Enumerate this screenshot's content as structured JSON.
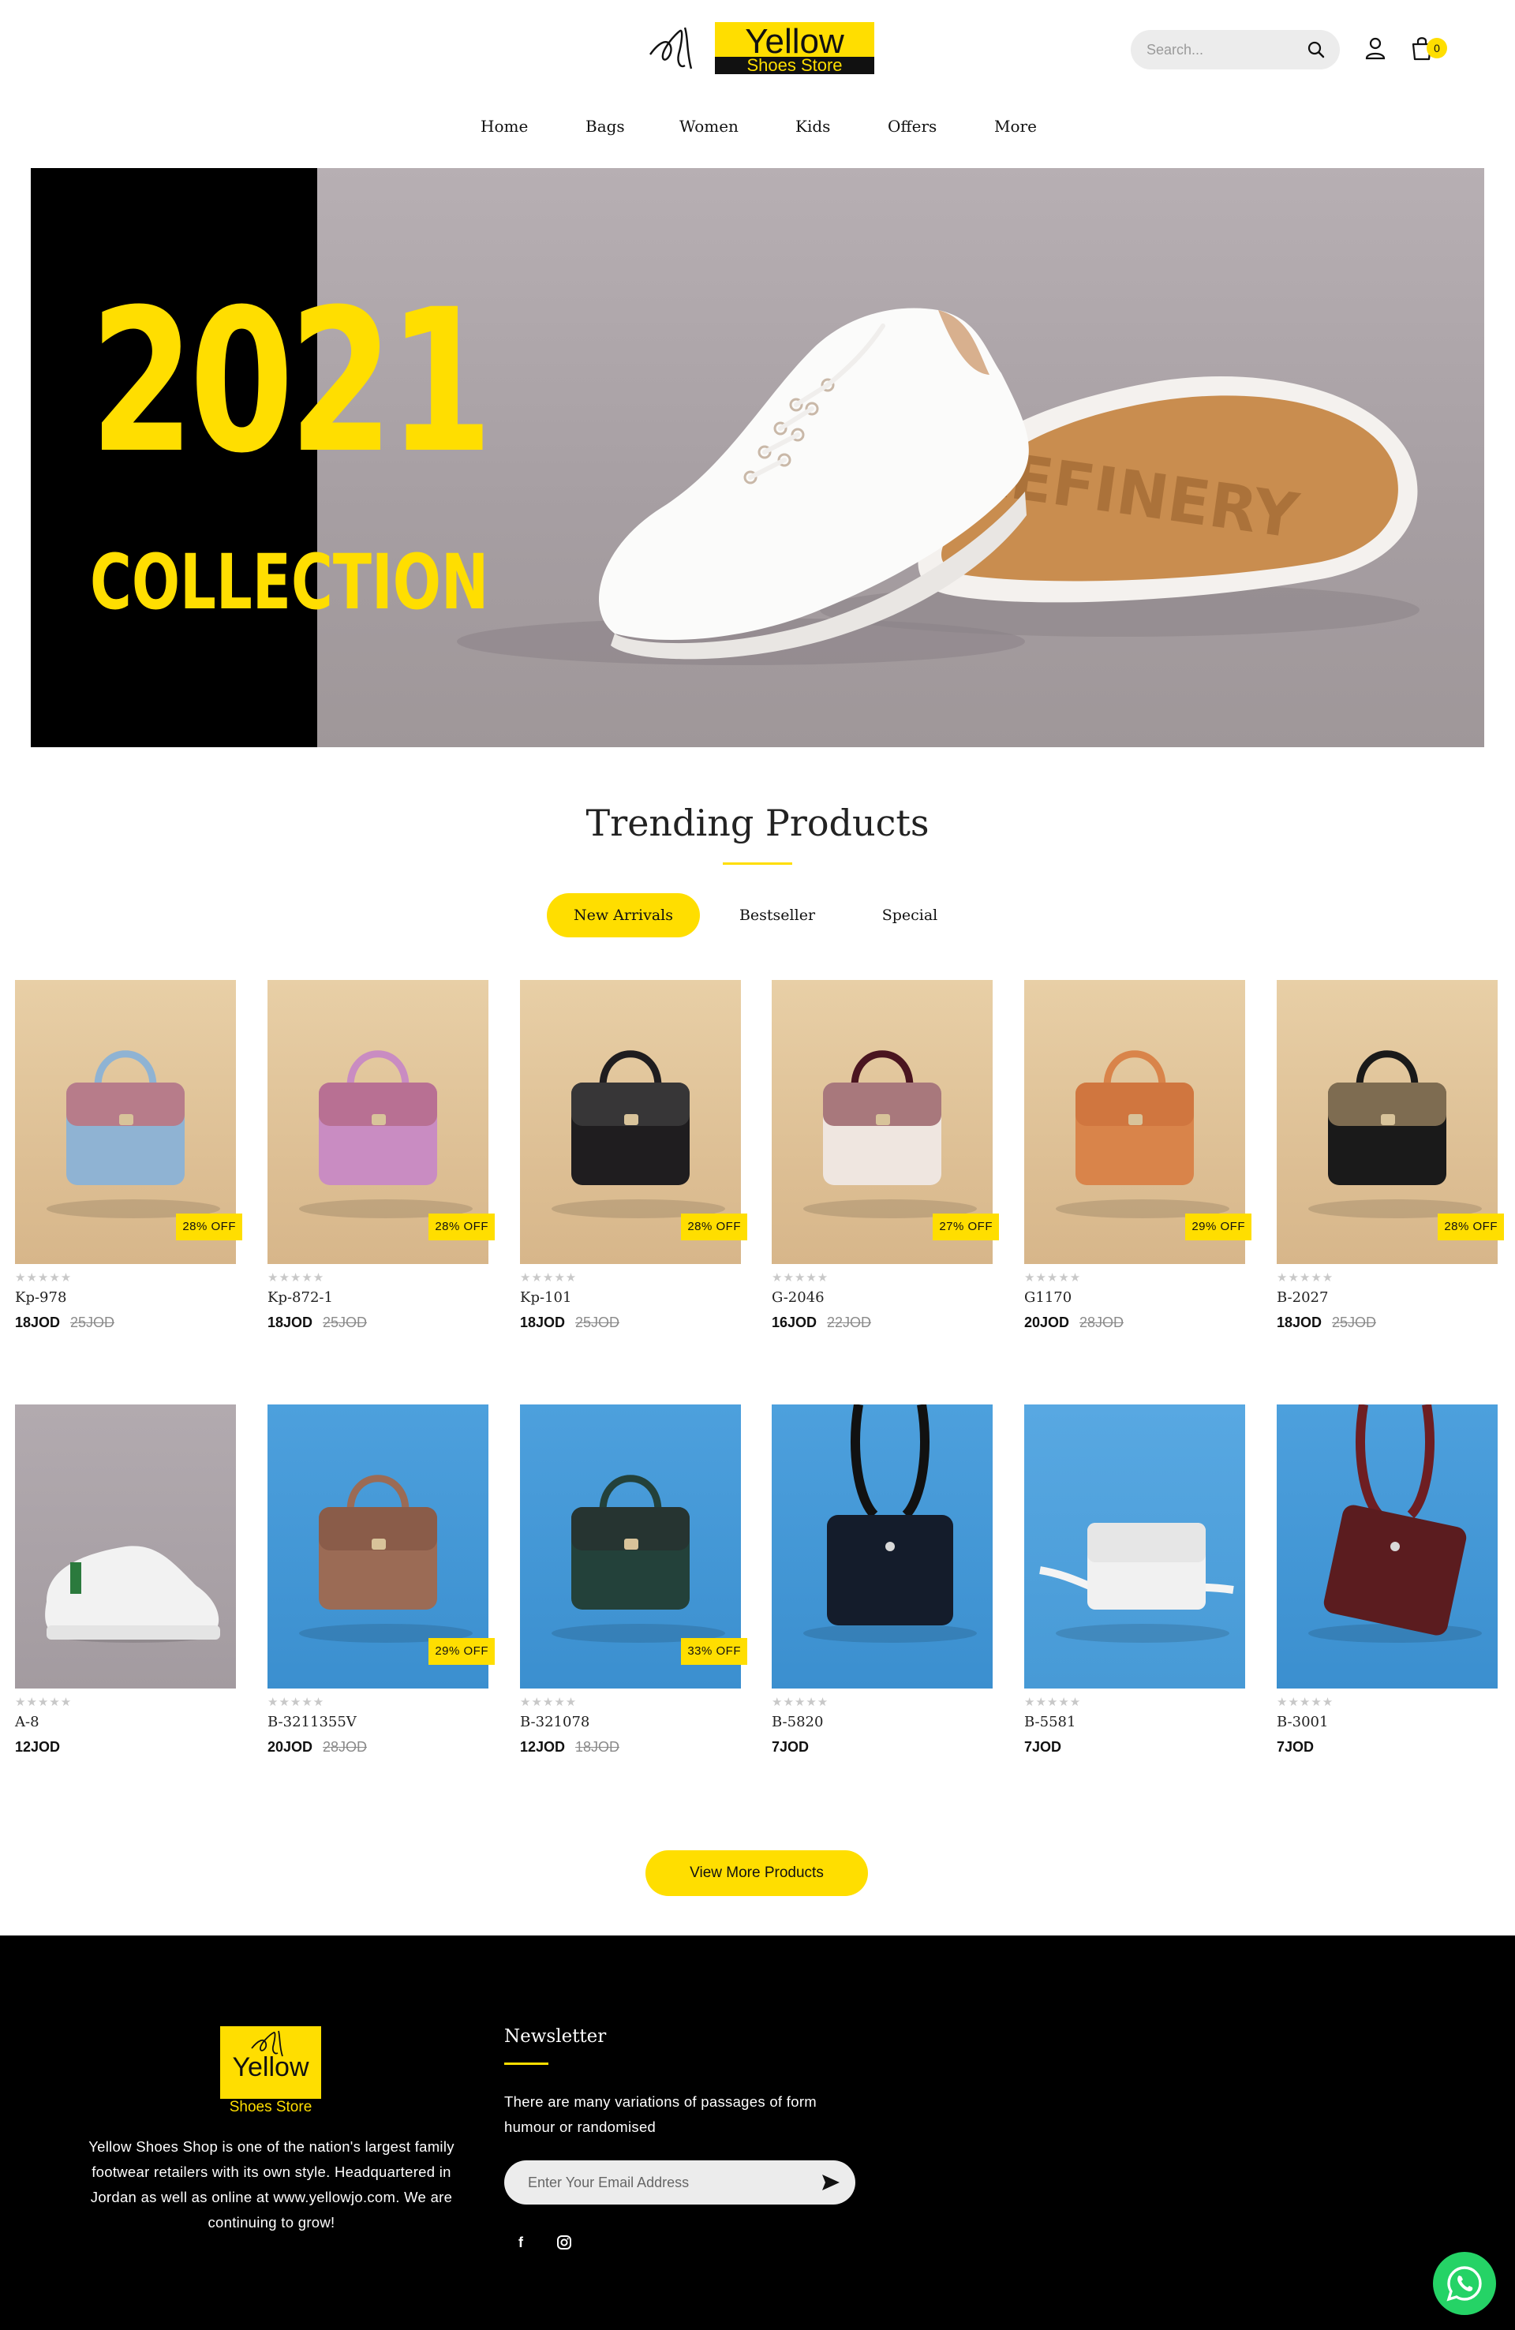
{
  "header": {
    "logo_text": "Yellow",
    "logo_subtext": "Shoes Store",
    "search_placeholder": "Search...",
    "cart_count": "0",
    "nav": [
      "Home",
      "Bags",
      "Women",
      "Kids",
      "Offers",
      "More"
    ]
  },
  "hero": {
    "year": "2021",
    "collection": "COLLECTION",
    "shoe_sole_text": "REFINERY"
  },
  "trending": {
    "title": "Trending Products",
    "tabs": [
      "New Arrivals",
      "Bestseller",
      "Special"
    ],
    "active_tab": "New Arrivals",
    "rating_stars": "★★★★★",
    "products": [
      {
        "name": "Kp-978",
        "price": "18JOD",
        "old_price": "25JOD",
        "discount": "28% OFF",
        "icon": "blue-handbag-image"
      },
      {
        "name": "Kp-872-1",
        "price": "18JOD",
        "old_price": "25JOD",
        "discount": "28% OFF",
        "icon": "pink-handbag-image"
      },
      {
        "name": "Kp-101",
        "price": "18JOD",
        "old_price": "25JOD",
        "discount": "28% OFF",
        "icon": "black-handbag-image"
      },
      {
        "name": "G-2046",
        "price": "16JOD",
        "old_price": "22JOD",
        "discount": "27% OFF",
        "icon": "burgundy-handbag-image"
      },
      {
        "name": "G1170",
        "price": "20JOD",
        "old_price": "28JOD",
        "discount": "29% OFF",
        "icon": "orange-handbag-image"
      },
      {
        "name": "B-2027",
        "price": "18JOD",
        "old_price": "25JOD",
        "discount": "28% OFF",
        "icon": "black-chain-bag-image"
      },
      {
        "name": "A-8",
        "price": "12JOD",
        "old_price": "",
        "discount": "",
        "icon": "white-sneaker-image"
      },
      {
        "name": "B-3211355V",
        "price": "20JOD",
        "old_price": "28JOD",
        "discount": "29% OFF",
        "icon": "brown-quilted-bag-image"
      },
      {
        "name": "B-321078",
        "price": "12JOD",
        "old_price": "18JOD",
        "discount": "33% OFF",
        "icon": "green-handbag-image"
      },
      {
        "name": "B-5820",
        "price": "7JOD",
        "old_price": "",
        "discount": "",
        "icon": "navy-box-bag-image"
      },
      {
        "name": "B-5581",
        "price": "7JOD",
        "old_price": "",
        "discount": "",
        "icon": "white-crossbody-bag-image"
      },
      {
        "name": "B-3001",
        "price": "7JOD",
        "old_price": "",
        "discount": "",
        "icon": "maroon-shoulder-bag-image"
      }
    ],
    "view_more": "View More Products"
  },
  "footer": {
    "logo_text": "Yellow",
    "logo_subtext": "Shoes Store",
    "about": "Yellow Shoes Shop is one of the nation's largest family footwear retailers with its own style. Headquartered in Jordan as well as online at www.yellowjo.com. We are continuing to grow!",
    "newsletter_title": "Newsletter",
    "newsletter_text": "There are many variations of passages of form humour or randomised",
    "email_placeholder": "Enter Your Email Address",
    "social": [
      "facebook-icon",
      "instagram-icon"
    ]
  },
  "colors": {
    "accent": "#ffde00",
    "footer_bg": "#000000",
    "whatsapp": "#25d366"
  }
}
